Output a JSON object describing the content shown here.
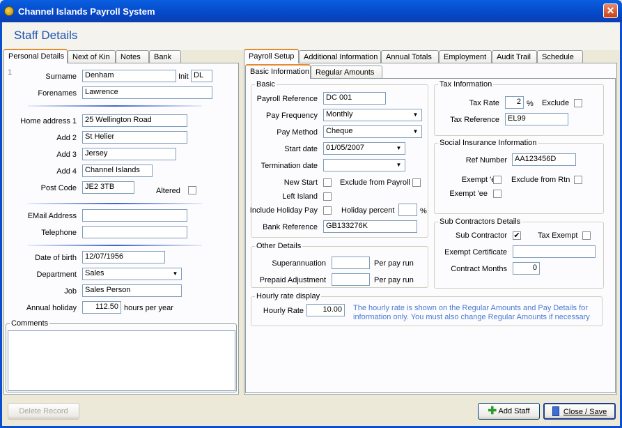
{
  "window": {
    "title": "Channel Islands Payroll System",
    "close_glyph": "✕"
  },
  "page_title": "Staff Details",
  "left_tabs": [
    "Personal Details",
    "Next of Kin",
    "Notes",
    "Bank"
  ],
  "right_tabs": [
    "Payroll Setup",
    "Additional Information",
    "Annual Totals",
    "Employment",
    "Audit Trail",
    "Schedule"
  ],
  "sub_tabs": [
    "Basic Information",
    "Regular Amounts"
  ],
  "personal": {
    "record_no": "1",
    "surname_label": "Surname",
    "surname": "Denham",
    "init_label": "Init",
    "init": "DL",
    "forenames_label": "Forenames",
    "forenames": "Lawrence",
    "addr1_label": "Home address 1",
    "addr1": "25 Wellington Road",
    "addr2_label": "Add 2",
    "addr2": "St Helier",
    "addr3_label": "Add 3",
    "addr3": "Jersey",
    "addr4_label": "Add 4",
    "addr4": "Channel Islands",
    "postcode_label": "Post Code",
    "postcode": "JE2 3TB",
    "altered_label": "Altered",
    "email_label": "EMail Address",
    "email": "",
    "phone_label": "Telephone",
    "phone": "",
    "dob_label": "Date of birth",
    "dob": "12/07/1956",
    "dept_label": "Department",
    "dept": "Sales",
    "job_label": "Job",
    "job": "Sales Person",
    "holiday_label": "Annual holiday",
    "holiday": "112.50",
    "holiday_unit": "hours per year",
    "comments_label": "Comments"
  },
  "basic": {
    "group": "Basic",
    "payref_label": "Payroll Reference",
    "payref": "DC 001",
    "freq_label": "Pay Frequency",
    "freq": "Monthly",
    "method_label": "Pay Method",
    "method": "Cheque",
    "start_label": "Start date",
    "start": "01/05/2007",
    "term_label": "Termination date",
    "term": "",
    "newstart_label": "New Start",
    "excl_payroll_label": "Exclude from Payroll",
    "left_island_label": "Left Island",
    "incl_holiday_label": "Include Holiday Pay",
    "holiday_pct_label": "Holiday percent",
    "holiday_pct": "",
    "pct_sign": "%",
    "bankref_label": "Bank Reference",
    "bankref": "GB133276K"
  },
  "other": {
    "group": "Other Details",
    "super_label": "Superannuation",
    "super": "",
    "super_unit": "Per pay run",
    "prepaid_label": "Prepaid Adjustment",
    "prepaid": "",
    "prepaid_unit": "Per pay run"
  },
  "hourly": {
    "group": "Hourly rate display",
    "rate_label": "Hourly Rate",
    "rate": "10.00",
    "note_line1": "The hourly rate is shown on the Regular Amounts and Pay Details for",
    "note_line2": "information only. You must also change Regular Amounts if necessary"
  },
  "tax": {
    "group": "Tax Information",
    "rate_label": "Tax Rate",
    "rate": "2",
    "pct_sign": "%",
    "exclude_label": "Exclude",
    "ref_label": "Tax Reference",
    "ref": "EL99"
  },
  "social": {
    "group": "Social Insurance Information",
    "ref_label": "Ref Number",
    "ref": "AA123456D",
    "exempt_er_label": "Exempt 'er",
    "excl_rtn_label": "Exclude from Rtn",
    "exempt_ee_label": "Exempt 'ee"
  },
  "subcon": {
    "group": "Sub Contractors Details",
    "sub_label": "Sub Contractor",
    "sub_checked": "✔",
    "tax_exempt_label": "Tax Exempt",
    "cert_label": "Exempt Certificate",
    "cert": "",
    "months_label": "Contract Months",
    "months": "0"
  },
  "footer": {
    "delete": "Delete Record",
    "add": "Add Staff",
    "close": "Close / Save"
  },
  "colors": {
    "titlebar": "#0548c8",
    "accent_title": "#1f55b5",
    "note_text": "#4a7ad0"
  }
}
